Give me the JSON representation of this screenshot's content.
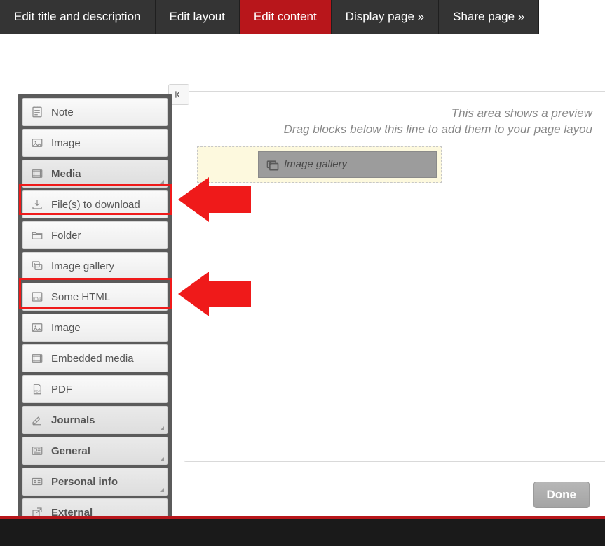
{
  "tabs": [
    {
      "label": "Edit title and description",
      "active": false
    },
    {
      "label": "Edit layout",
      "active": false
    },
    {
      "label": "Edit content",
      "active": true
    },
    {
      "label": "Display page »",
      "active": false
    },
    {
      "label": "Share page »",
      "active": false
    }
  ],
  "preview": {
    "hint_line1": "This area shows a preview",
    "hint_line2": "Drag blocks below this line to add them to your page layou",
    "dragged_block_label": "Image gallery"
  },
  "sidebar": {
    "items": [
      {
        "key": "note",
        "label": "Note",
        "icon": "note-icon",
        "type": "item"
      },
      {
        "key": "image1",
        "label": "Image",
        "icon": "image-icon",
        "type": "item"
      },
      {
        "key": "media",
        "label": "Media",
        "icon": "media-icon",
        "type": "section",
        "highlight": true
      },
      {
        "key": "files",
        "label": "File(s) to download",
        "icon": "download-icon",
        "type": "item"
      },
      {
        "key": "folder",
        "label": "Folder",
        "icon": "folder-icon",
        "type": "item"
      },
      {
        "key": "gallery",
        "label": "Image gallery",
        "icon": "gallery-icon",
        "type": "item",
        "highlight": true
      },
      {
        "key": "html",
        "label": "Some HTML",
        "icon": "html-icon",
        "type": "item"
      },
      {
        "key": "image2",
        "label": "Image",
        "icon": "image-icon",
        "type": "item"
      },
      {
        "key": "embed",
        "label": "Embedded media",
        "icon": "media-icon",
        "type": "item"
      },
      {
        "key": "pdf",
        "label": "PDF",
        "icon": "pdf-icon",
        "type": "item"
      },
      {
        "key": "journals",
        "label": "Journals",
        "icon": "pencil-icon",
        "type": "section"
      },
      {
        "key": "general",
        "label": "General",
        "icon": "news-icon",
        "type": "section"
      },
      {
        "key": "personal",
        "label": "Personal info",
        "icon": "card-icon",
        "type": "section"
      },
      {
        "key": "external",
        "label": "External",
        "icon": "external-icon",
        "type": "section"
      }
    ]
  },
  "done_label": "Done"
}
